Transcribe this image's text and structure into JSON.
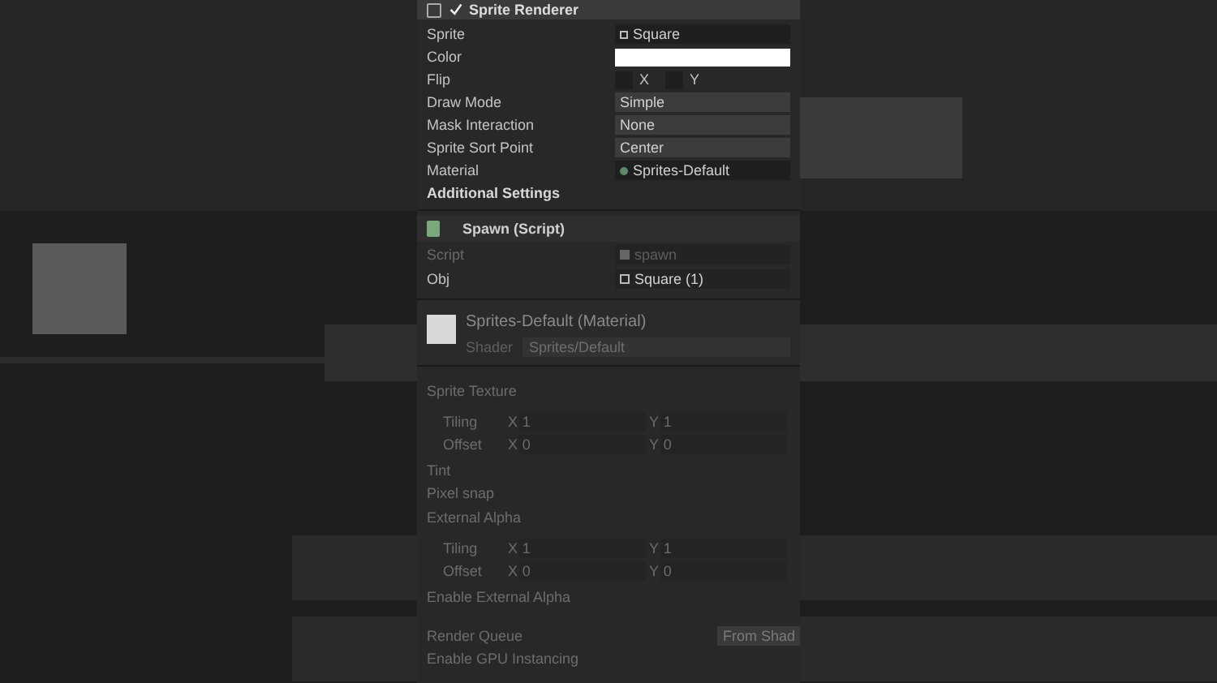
{
  "sprite_renderer": {
    "title": "Sprite Renderer",
    "enabled": true,
    "fields": [
      {
        "label": "Sprite",
        "kind": "object",
        "value": "Square"
      },
      {
        "label": "Color",
        "kind": "color",
        "color": "#ffffff"
      },
      {
        "label": "Flip",
        "kind": "flip",
        "options": [
          {
            "label": "X",
            "checked": false
          },
          {
            "label": "Y",
            "checked": false
          }
        ]
      },
      {
        "label": "Draw Mode",
        "kind": "dropdown",
        "value": "Simple"
      },
      {
        "label": "Mask Interaction",
        "kind": "dropdown",
        "value": "None"
      },
      {
        "label": "Sprite Sort Point",
        "kind": "dropdown",
        "value": "Center"
      },
      {
        "label": "Material",
        "kind": "material",
        "value": "Sprites-Default"
      }
    ],
    "additional_settings": "Additional Settings"
  },
  "spawn": {
    "title": "Spawn (Script)",
    "fields": [
      {
        "label": "Script",
        "value": "spawn",
        "disabled": true
      },
      {
        "label": "Obj",
        "value": "Square (1)",
        "disabled": false
      }
    ]
  },
  "material": {
    "title": "Sprites-Default (Material)",
    "shader_label": "Shader",
    "shader_value": "Sprites/Default",
    "items": [
      {
        "kind": "heading",
        "label": "Sprite Texture"
      },
      {
        "kind": "vector",
        "label": "Tiling",
        "x_label": "X",
        "x_value": "1",
        "y_label": "Y",
        "y_value": "1"
      },
      {
        "kind": "vector",
        "label": "Offset",
        "x_label": "X",
        "x_value": "0",
        "y_label": "Y",
        "y_value": "0"
      },
      {
        "kind": "label",
        "label": "Tint"
      },
      {
        "kind": "label",
        "label": "Pixel snap"
      },
      {
        "kind": "heading",
        "label": "External Alpha"
      },
      {
        "kind": "vector",
        "label": "Tiling",
        "x_label": "X",
        "x_value": "1",
        "y_label": "Y",
        "y_value": "1"
      },
      {
        "kind": "vector",
        "label": "Offset",
        "x_label": "X",
        "x_value": "0",
        "y_label": "Y",
        "y_value": "0"
      },
      {
        "kind": "label",
        "label": "Enable External Alpha"
      },
      {
        "kind": "button",
        "label": "Render Queue",
        "value": "From Shad"
      },
      {
        "kind": "label",
        "label": "Enable GPU Instancing"
      }
    ]
  }
}
